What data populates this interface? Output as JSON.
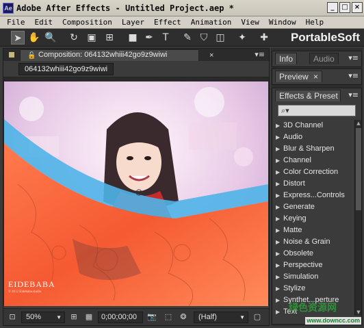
{
  "window": {
    "logo": "Ae",
    "title": "Adobe After Effects - Untitled Project.aep *",
    "buttons": [
      "_",
      "□",
      "×"
    ]
  },
  "menu": [
    "File",
    "Edit",
    "Composition",
    "Layer",
    "Effect",
    "Animation",
    "View",
    "Window",
    "Help"
  ],
  "toolbar": {
    "tools": [
      {
        "name": "selection-tool-icon",
        "glyph": "➤"
      },
      {
        "name": "hand-tool-icon",
        "glyph": "✋"
      },
      {
        "name": "zoom-tool-icon",
        "glyph": "🔍"
      },
      {
        "name": "rotation-tool-icon",
        "glyph": "↻"
      },
      {
        "name": "camera-tool-icon",
        "glyph": "▣"
      },
      {
        "name": "pan-behind-tool-icon",
        "glyph": "⊞"
      },
      {
        "name": "rectangle-tool-icon",
        "glyph": "■"
      },
      {
        "name": "pen-tool-icon",
        "glyph": "✒"
      },
      {
        "name": "text-tool-icon",
        "glyph": "T"
      },
      {
        "name": "brush-tool-icon",
        "glyph": "✎"
      },
      {
        "name": "clone-stamp-tool-icon",
        "glyph": "⛉"
      },
      {
        "name": "eraser-tool-icon",
        "glyph": "◫"
      },
      {
        "name": "puppet-tool-icon",
        "glyph": "✦"
      },
      {
        "name": "pin-tool-icon",
        "glyph": "✚"
      }
    ],
    "brand": "PortableSoft"
  },
  "composition": {
    "tab_label": "Composition: 064132whiii42go9z9wiwi",
    "subtab_label": "064132whiii42go9z9wiwi",
    "watermark": "EIDEBABA",
    "watermark_sub": "© 2012 Eidebaba.studio",
    "footer": {
      "zoom": "50%",
      "timecode": "0;00;00;00",
      "resolution": "(Half)"
    }
  },
  "panels": {
    "info": "Info",
    "audio": "Audio",
    "preview": "Preview",
    "effects": "Effects & Preset",
    "search_placeholder": "⌕▾"
  },
  "effects": [
    "3D Channel",
    "Audio",
    "Blur & Sharpen",
    "Channel",
    "Color Correction",
    "Distort",
    "Express...Controls",
    "Generate",
    "Keying",
    "Matte",
    "Noise & Grain",
    "Obsolete",
    "Perspective",
    "Simulation",
    "Stylize",
    "Synthet...perture",
    "Text"
  ],
  "site": {
    "brand": "绿色资源网",
    "url": "www.downcc.com"
  },
  "colors": {
    "accent_tab": "#c7b77a",
    "panel_bg": "#3b3b3b",
    "scarf": "#ff6a3c"
  }
}
